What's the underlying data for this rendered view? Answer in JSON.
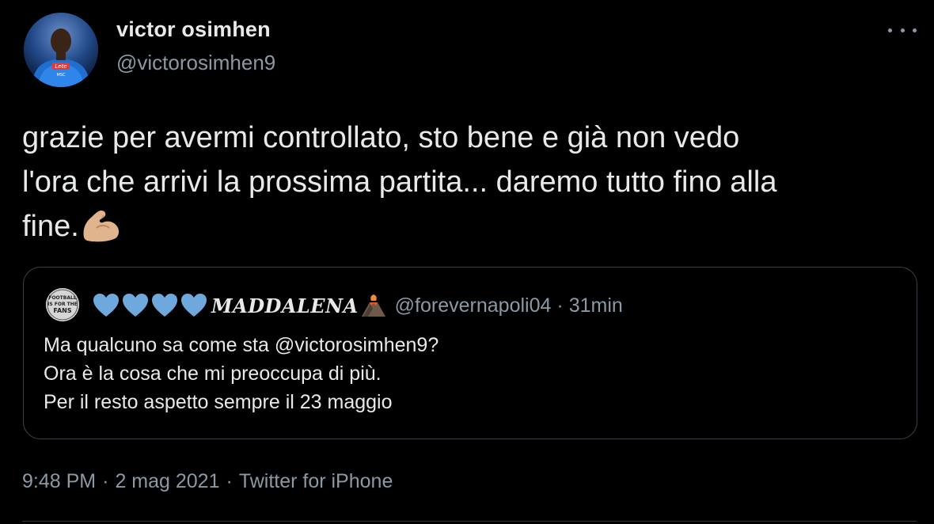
{
  "author": {
    "display_name": "victor osimhen",
    "handle": "@victorosimhen9",
    "avatar_icon": "profile-photo"
  },
  "tweet": {
    "text": "grazie per avermi controllato, sto bene e già non vedo\nl'ora che arrivi la prossima partita... daremo tutto fino alla\nfine.",
    "emoji": "flexed-biceps"
  },
  "quoted_tweet": {
    "name_text": "MADDALENA",
    "hearts_count": 4,
    "heart_color": "#6fa8dc",
    "handle": "@forevernapoli04",
    "separator": "·",
    "time": "31min",
    "lines": [
      "Ma qualcuno sa come sta @victorosimhen9?",
      "Ora è la cosa che mi preoccupa di più.",
      "Per il resto aspetto sempre il 23 maggio"
    ],
    "avatar_text": "FOOTBALL IS FOR THE FANS"
  },
  "meta": {
    "time": "9:48 PM",
    "separator": "·",
    "date": "2 mag 2021",
    "source": "Twitter for iPhone"
  },
  "colors": {
    "background": "#000000",
    "primary_text": "#e7e9ea",
    "secondary_text": "#8b98a5",
    "border": "#3a4148"
  }
}
